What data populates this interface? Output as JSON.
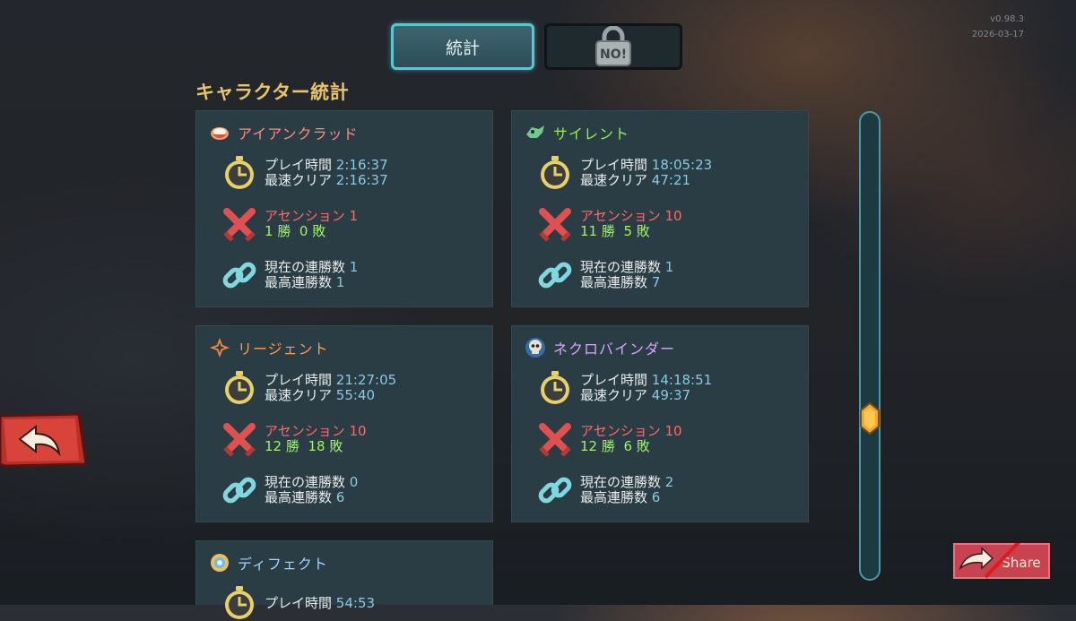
{
  "version": {
    "number": "v0.98.3",
    "date": "2026-03-17"
  },
  "tabs": {
    "stats_label": "統計",
    "locked_label": "NO!"
  },
  "section_title": "キャラクター統計",
  "labels": {
    "playtime": "プレイ時間",
    "fastest_clear": "最速クリア",
    "ascension": "アセンション",
    "current_streak": "現在の連勝数",
    "best_streak": "最高連勝数",
    "wins_suffix": "勝",
    "losses_suffix": "敗"
  },
  "characters": [
    {
      "name": "アイアンクラッド",
      "color": "#ff8a80",
      "playtime": "2:16:37",
      "fastest": "2:16:37",
      "ascension": "1",
      "wins": "1",
      "losses": "0",
      "current_streak": "1",
      "best_streak": "1"
    },
    {
      "name": "サイレント",
      "color": "#8ff05a",
      "playtime": "18:05:23",
      "fastest": "47:21",
      "ascension": "10",
      "wins": "11",
      "losses": "5",
      "current_streak": "1",
      "best_streak": "7"
    },
    {
      "name": "リージェント",
      "color": "#ff9b52",
      "playtime": "21:27:05",
      "fastest": "55:40",
      "ascension": "10",
      "wins": "12",
      "losses": "18",
      "current_streak": "0",
      "best_streak": "6"
    },
    {
      "name": "ネクロバインダー",
      "color": "#d9a6ff",
      "playtime": "14:18:51",
      "fastest": "49:37",
      "ascension": "10",
      "wins": "12",
      "losses": "6",
      "current_streak": "2",
      "best_streak": "6"
    },
    {
      "name": "ディフェクト",
      "color": "#9fd6ff",
      "playtime": "54:53"
    }
  ],
  "share_label": "Share"
}
